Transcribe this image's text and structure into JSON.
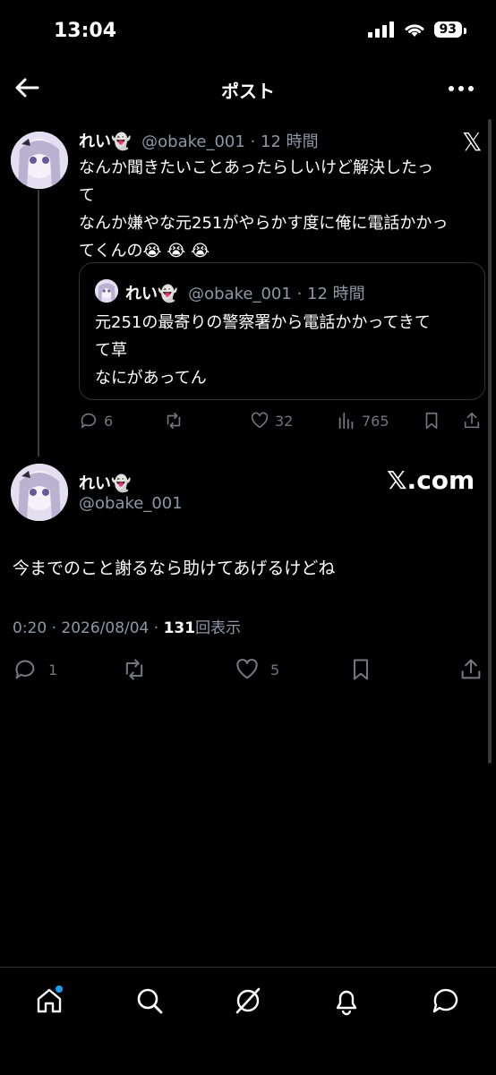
{
  "status_bar": {
    "time": "13:04",
    "battery": "93"
  },
  "header": {
    "title": "ポスト"
  },
  "original_post": {
    "display_name": "れい👻",
    "handle": "@obake_001",
    "time": "· 12 時間",
    "text_lines": [
      "なんか聞きたいことあったらしいけど解決したっ",
      "て",
      "なんか嫌やな元251がやらかす度に俺に電話かかっ",
      "てくんの😭 😭 😭"
    ],
    "quote": {
      "display_name": "れい👻",
      "handle": "@obake_001",
      "time": "· 12 時間",
      "text_lines": [
        "元251の最寄りの警察署から電話かかってきて",
        "て草",
        "なにがあってん"
      ]
    },
    "replies": "6",
    "likes": "32",
    "views": "765"
  },
  "main_post": {
    "display_name": "れい👻",
    "handle": "@obake_001",
    "text": "今までのこと謝るなら助けてあげるけどね",
    "date": "0:20 · 2026/08/04 · ",
    "views_count": "131",
    "views_label": "回表示",
    "replies": "1",
    "likes": "5"
  },
  "watermark": {
    "x_com": "𝕏.com"
  },
  "colors": {
    "background": "#000000",
    "muted": "#71767b",
    "accent": "#1d9bf0"
  }
}
